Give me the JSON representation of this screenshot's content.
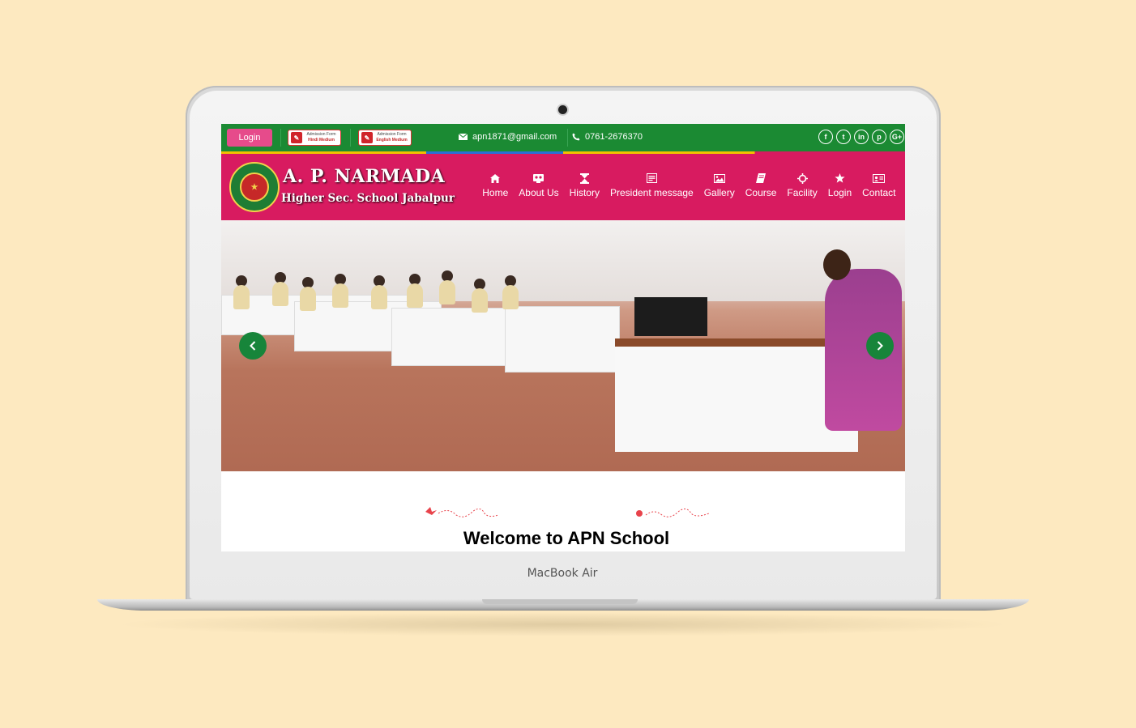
{
  "device": {
    "brand_label": "MacBook Air"
  },
  "topbar": {
    "login_label": "Login",
    "admission_buttons": [
      {
        "line1": "Admission Form",
        "line2": "Hindi Medium"
      },
      {
        "line1": "Admission Form",
        "line2": "English Medium"
      }
    ],
    "email": "apn1871@gmail.com",
    "phone": "0761-2676370",
    "socials": [
      "facebook-icon",
      "twitter-icon",
      "linkedin-icon",
      "pinterest-icon",
      "google-plus-icon"
    ],
    "colors": {
      "bar": "#1b8a33",
      "login": "#e64b8b"
    }
  },
  "header": {
    "school_name": "A. P. NARMADA",
    "school_subtitle": "Higher Sec. School Jabalpur",
    "nav": [
      {
        "label": "Home",
        "icon": "home-icon"
      },
      {
        "label": "About Us",
        "icon": "about-icon"
      },
      {
        "label": "History",
        "icon": "hourglass-icon"
      },
      {
        "label": "President message",
        "icon": "message-icon"
      },
      {
        "label": "Gallery",
        "icon": "image-icon"
      },
      {
        "label": "Course",
        "icon": "book-icon"
      },
      {
        "label": "Facility",
        "icon": "crosshair-icon"
      },
      {
        "label": "Login",
        "icon": "star-icon"
      },
      {
        "label": "Contact",
        "icon": "contact-card-icon"
      }
    ],
    "colors": {
      "bar": "#d81b60"
    }
  },
  "hero": {
    "prev_icon": "chevron-left-icon",
    "next_icon": "chevron-right-icon",
    "arrow_color": "#17853a"
  },
  "welcome": {
    "title": "Welcome to APN School"
  }
}
